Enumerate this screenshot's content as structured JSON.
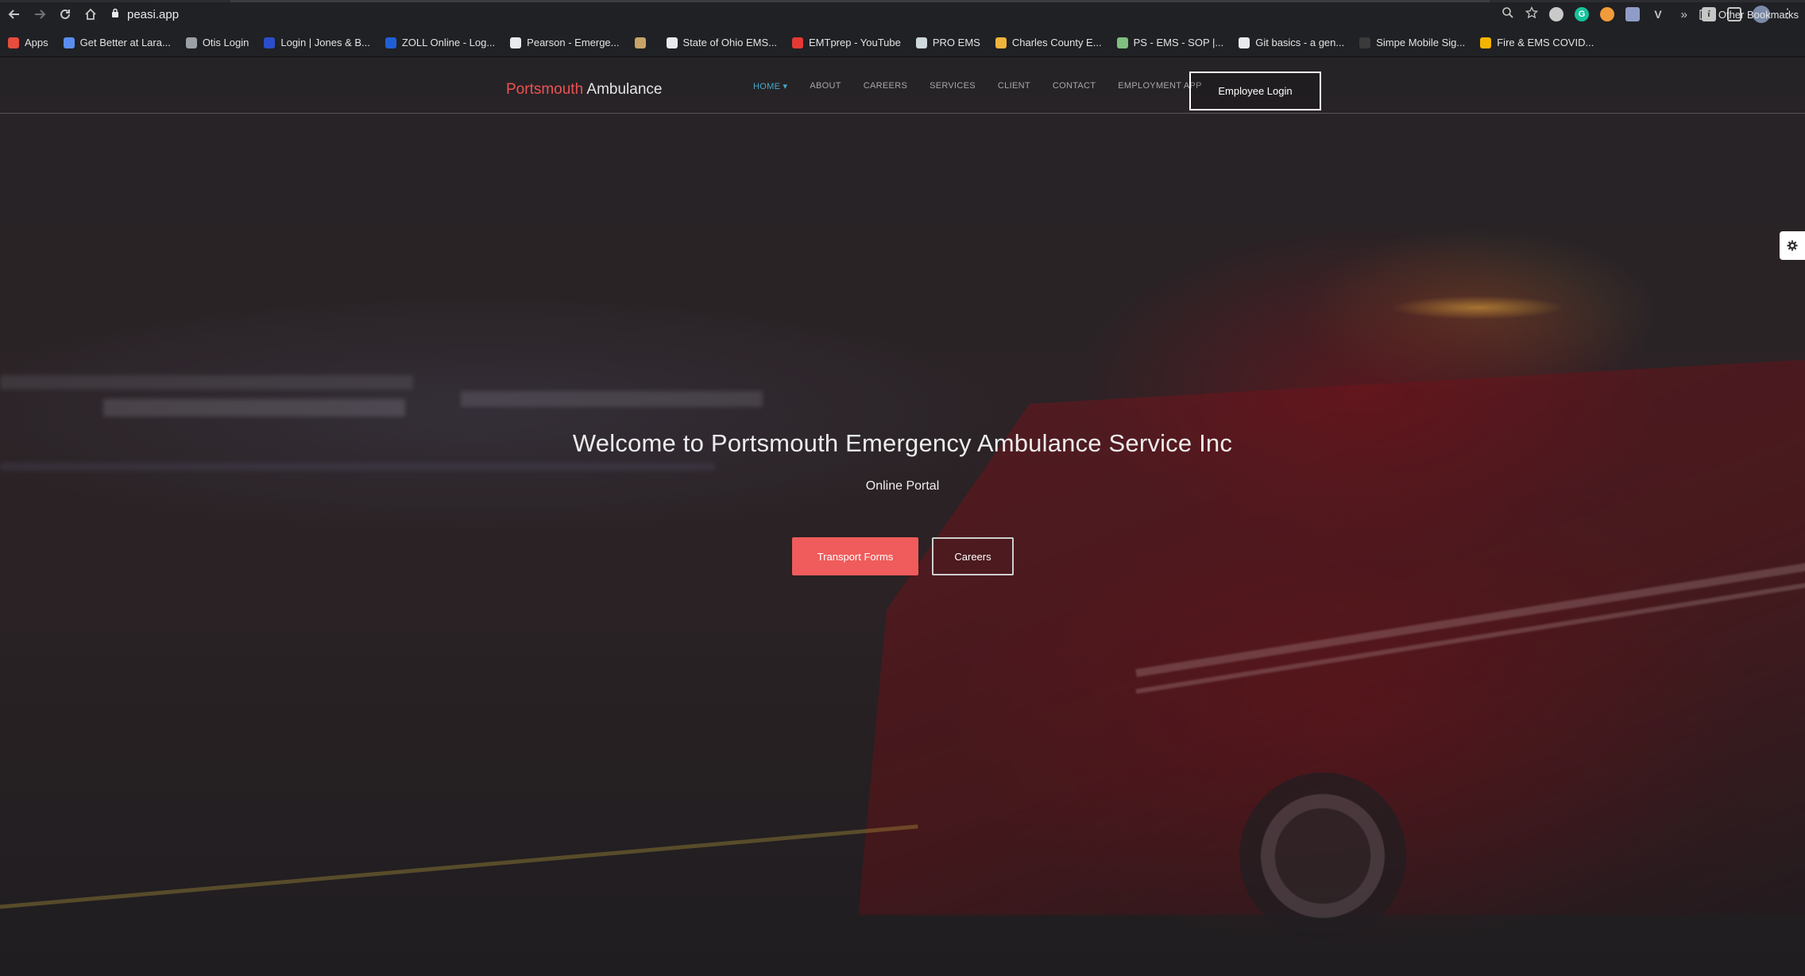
{
  "browser": {
    "url": "peasi.app",
    "bookmarks": [
      {
        "label": "Apps",
        "color": "#e74c3c"
      },
      {
        "label": "Get Better at Lara...",
        "color": "#5b8def"
      },
      {
        "label": "Otis Login",
        "color": "#9aa0a6"
      },
      {
        "label": "Login | Jones & B...",
        "color": "#2b4dcc"
      },
      {
        "label": "ZOLL Online - Log...",
        "color": "#1f5fd6"
      },
      {
        "label": "Pearson - Emerge...",
        "color": "#e8eaed"
      },
      {
        "label": "",
        "color": "#c8a46a"
      },
      {
        "label": "State of Ohio EMS...",
        "color": "#e8eaed"
      },
      {
        "label": "EMTprep - YouTube",
        "color": "#e53935"
      },
      {
        "label": "PRO EMS",
        "color": "#cfd8dc"
      },
      {
        "label": "Charles County E...",
        "color": "#f0b43c"
      },
      {
        "label": "PS - EMS - SOP |...",
        "color": "#7fbf7f"
      },
      {
        "label": "Git basics - a gen...",
        "color": "#e8eaed"
      },
      {
        "label": "Simpe Mobile Sig...",
        "color": "#3a3a3a"
      },
      {
        "label": "Fire & EMS COVID...",
        "color": "#f4b400"
      }
    ],
    "other_bookmarks": "Other Bookmarks"
  },
  "site": {
    "logo_red": "Portsmouth",
    "logo_white": "Ambulance",
    "menu": [
      "HOME ▾",
      "ABOUT",
      "CAREERS",
      "SERVICES",
      "CLIENT",
      "CONTACT",
      "EMPLOYMENT APP"
    ],
    "employee_login": "Employee Login"
  },
  "hero": {
    "title": "Welcome to Portsmouth Emergency Ambulance Service Inc",
    "subtitle": "Online Portal",
    "primary_button": "Transport Forms",
    "secondary_button": "Careers"
  },
  "colors": {
    "accent_red": "#f05b5b",
    "nav_active": "#44a9c9"
  }
}
